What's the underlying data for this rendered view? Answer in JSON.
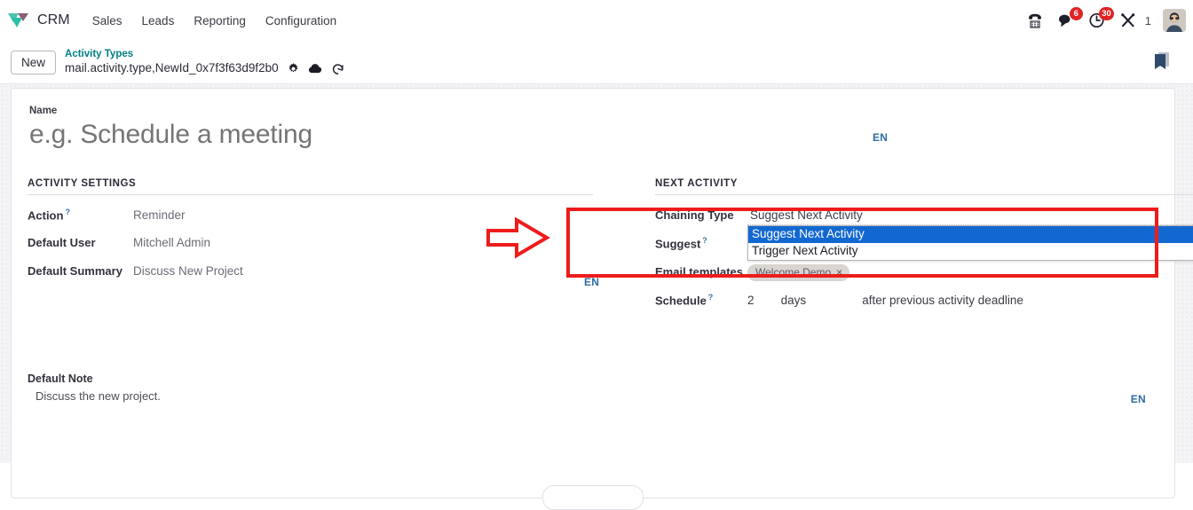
{
  "navbar": {
    "brand": "CRM",
    "brand_logo_icon": "odoo-crm-logo-icon",
    "menu": [
      {
        "label": "Sales",
        "name": "menu-item-sales"
      },
      {
        "label": "Leads",
        "name": "menu-item-leads"
      },
      {
        "label": "Reporting",
        "name": "menu-item-reporting"
      },
      {
        "label": "Configuration",
        "name": "menu-item-configuration"
      }
    ],
    "systray": {
      "phone_icon": "phone-icon",
      "messages_icon": "chat-bubble-icon",
      "messages_count": "6",
      "activities_icon": "clock-icon",
      "activities_count": "30",
      "tools_icon": "tools-icon",
      "tools_count": "1",
      "avatar_icon": "user-avatar"
    }
  },
  "control_panel": {
    "new_button": "New",
    "breadcrumb_parent": "Activity Types",
    "breadcrumb_current": "mail.activity.type,NewId_0x7f3f63d9f2b0",
    "gear_icon": "gear-icon",
    "cloud_icon": "cloud-upload-icon",
    "discard_icon": "undo-discard-icon",
    "bookmark_icon": "bookmark-icon"
  },
  "form": {
    "name_label": "Name",
    "name_value": "",
    "name_placeholder": "e.g. Schedule a meeting",
    "lang_code": "EN",
    "activity_settings": {
      "title": "ACTIVITY SETTINGS",
      "rows": [
        {
          "label": "Action",
          "help": "?",
          "value": "Reminder"
        },
        {
          "label": "Default User",
          "help": "",
          "value": "Mitchell Admin"
        },
        {
          "label": "Default Summary",
          "help": "",
          "value": "Discuss New Project"
        }
      ]
    },
    "next_activity": {
      "title": "NEXT ACTIVITY",
      "chaining_type_label": "Chaining Type",
      "chaining_type_value": "Suggest Next Activity",
      "chaining_type_options": [
        "Suggest Next Activity",
        "Trigger Next Activity"
      ],
      "chaining_type_selected_index": 0,
      "suggest_label": "Suggest",
      "suggest_help": "?",
      "email_templates_label": "Email templates",
      "email_template_tag": "Welcome Demo",
      "email_template_remove": "×",
      "schedule_label": "Schedule",
      "schedule_help": "?",
      "schedule_number": "2",
      "schedule_unit": "days",
      "schedule_after": "after previous activity deadline"
    },
    "default_note": {
      "label": "Default Note",
      "value": "Discuss the new project.",
      "lang_code": "EN"
    },
    "lang_code_mid": "EN",
    "lang_code_note": "EN"
  },
  "annotation": {
    "highlight_color": "#ee1c1c",
    "arrow_name": "red-pointer-arrow",
    "box_name": "red-highlight-box"
  },
  "colors": {
    "accent_teal": "#017e84",
    "badge_red": "#e02424",
    "select_highlight": "#1268d0",
    "annotation_red": "#ee1c1c"
  }
}
